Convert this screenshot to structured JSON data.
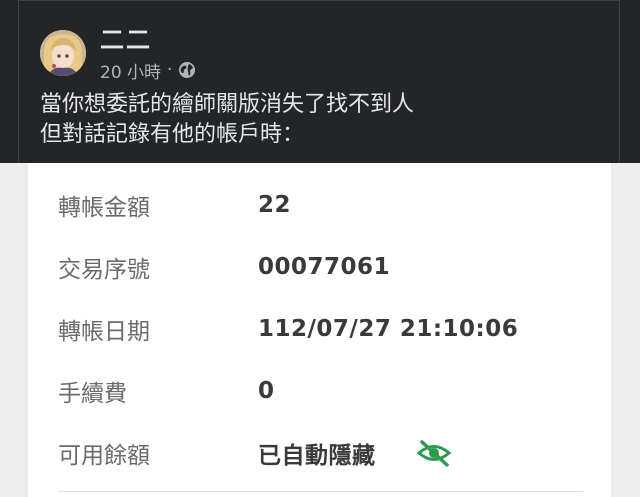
{
  "post": {
    "author": "二二",
    "time": "20 小時",
    "separator": "·",
    "privacy_icon": "globe-icon",
    "text_lines": [
      "當你想委託的繪師關版消失了找不到人",
      "但對話記錄有他的帳戶時："
    ]
  },
  "transfer": {
    "rows": [
      {
        "label": "轉帳金額",
        "value": "22"
      },
      {
        "label": "交易序號",
        "value": "00077061"
      },
      {
        "label": "轉帳日期",
        "value": "112/07/27 21:10:06"
      },
      {
        "label": "手續費",
        "value": "0"
      },
      {
        "label": "可用餘額",
        "value": "已自動隱藏",
        "icon": "eye-hidden-icon"
      }
    ]
  },
  "colors": {
    "post_background": "#242526",
    "card_background": "#ffffff",
    "eye_icon": "#2e9a4e"
  }
}
